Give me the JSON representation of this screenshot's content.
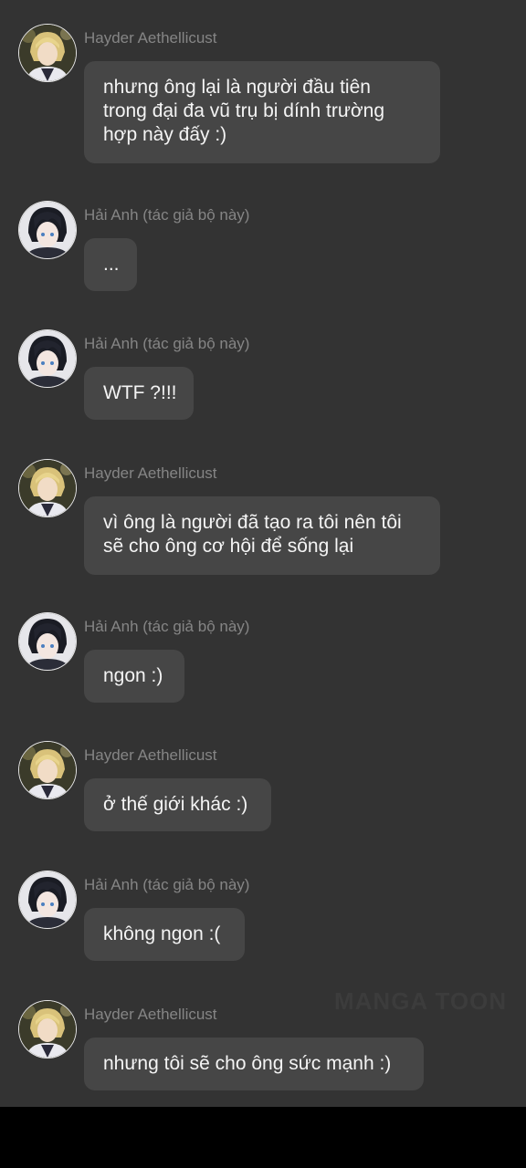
{
  "watermark": "MANGA TOON",
  "colors": {
    "background": "#333333",
    "bubble": "#464646",
    "sender": "#858585",
    "text": "#f4f4f4"
  },
  "messages": [
    {
      "sender": "Hayder Aethellicust",
      "avatar": "blonde-knight-avatar",
      "lines": [
        "nhưng ông lại là người đầu tiên",
        "trong đại đa vũ trụ bị dính trường",
        "hợp này đấy :)"
      ]
    },
    {
      "sender": "Hải Anh (tác giả bộ này)",
      "avatar": "dark-hair-boy-avatar",
      "lines": [
        "..."
      ]
    },
    {
      "sender": "Hải Anh (tác giả bộ này)",
      "avatar": "dark-hair-boy-avatar",
      "lines": [
        "WTF ?!!!"
      ]
    },
    {
      "sender": "Hayder Aethellicust",
      "avatar": "blonde-knight-avatar",
      "lines": [
        "vì ông là người đã tạo ra tôi nên tôi",
        "sẽ cho ông cơ hội để sống lại"
      ]
    },
    {
      "sender": "Hải Anh (tác giả bộ này)",
      "avatar": "dark-hair-boy-avatar",
      "lines": [
        "ngon :)"
      ]
    },
    {
      "sender": "Hayder Aethellicust",
      "avatar": "blonde-knight-avatar",
      "lines": [
        "ở thế giới khác :)"
      ]
    },
    {
      "sender": "Hải Anh (tác giả bộ này)",
      "avatar": "dark-hair-boy-avatar",
      "lines": [
        "không ngon :("
      ]
    },
    {
      "sender": "Hayder Aethellicust",
      "avatar": "blonde-knight-avatar",
      "lines": [
        "nhưng tôi sẽ cho ông sức mạnh :)"
      ]
    }
  ]
}
